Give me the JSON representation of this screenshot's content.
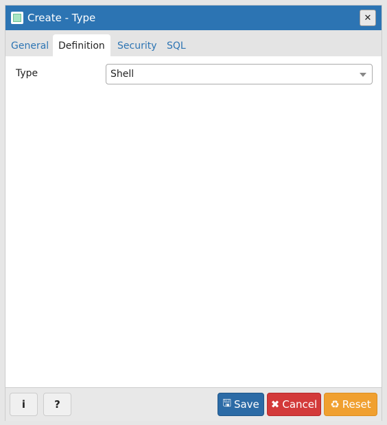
{
  "title": "Create - Type",
  "tabs": [
    "General",
    "Definition",
    "Security",
    "SQL"
  ],
  "active_tab": "Definition",
  "form": {
    "type_label": "Type",
    "type_value": "Shell"
  },
  "footer": {
    "info": "i",
    "help": "?",
    "save": "Save",
    "cancel": "Cancel",
    "reset": "Reset"
  },
  "colors": {
    "titlebar": "#2c74b3",
    "save": "#2c6ba6",
    "cancel": "#d33a3a",
    "reset": "#f0a030"
  }
}
